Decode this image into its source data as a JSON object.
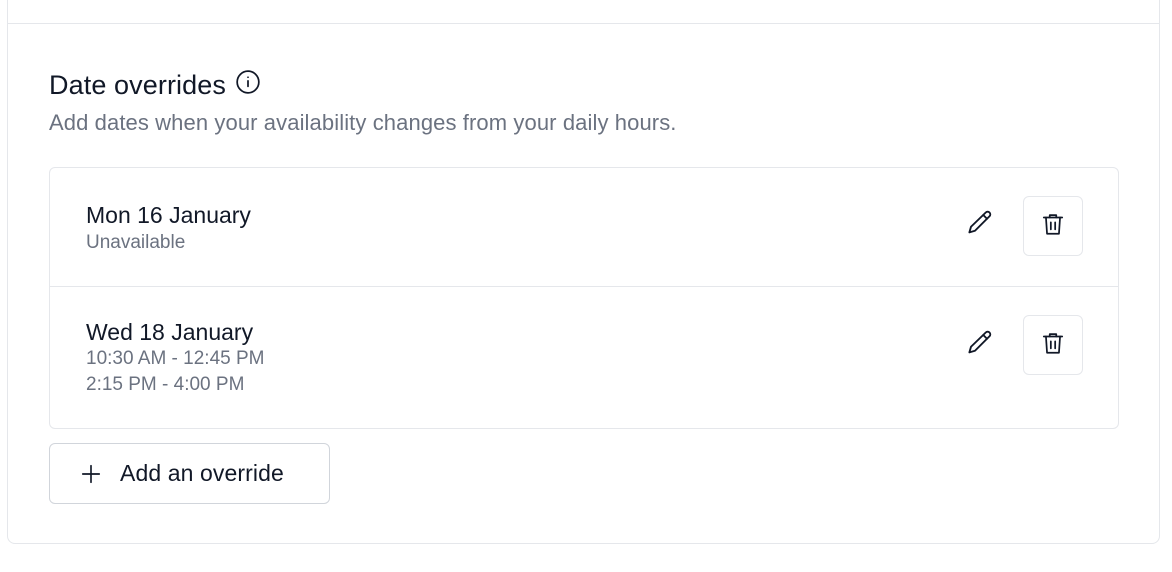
{
  "section": {
    "title": "Date overrides",
    "subtitle": "Add dates when your availability changes from your daily hours."
  },
  "overrides": [
    {
      "date": "Mon 16 January",
      "details": [
        "Unavailable"
      ]
    },
    {
      "date": "Wed 18 January",
      "details": [
        "10:30 AM - 12:45 PM",
        "2:15 PM - 4:00 PM"
      ]
    }
  ],
  "add_button": {
    "label": "Add an override"
  },
  "icons": {
    "info": "info-icon",
    "edit": "pencil-icon",
    "delete": "trash-icon",
    "add": "plus-icon"
  },
  "colors": {
    "text": "#111827",
    "muted": "#6b7280",
    "border": "#e5e7eb"
  }
}
